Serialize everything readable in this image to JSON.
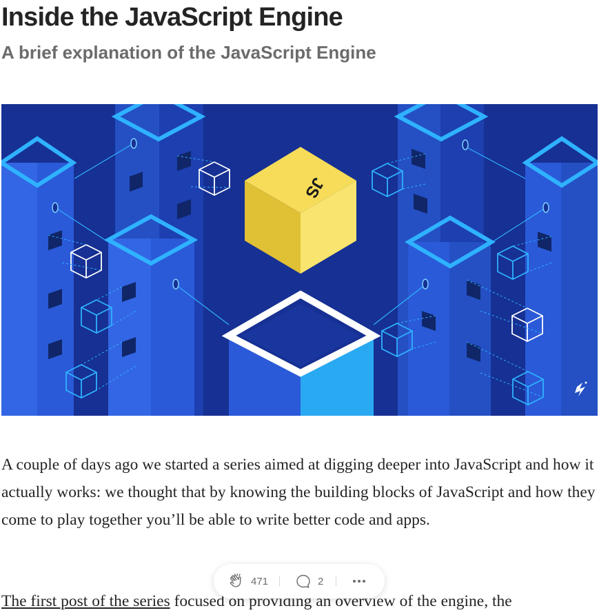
{
  "article": {
    "title": "Inside the JavaScript Engine",
    "subtitle": "A brief explanation of the JavaScript Engine",
    "hero_image": {
      "cube_label": "JS",
      "colors": {
        "background": "#163093",
        "pillar": "#2a5ad8",
        "pillar_light": "#3a72ee",
        "outline": "#2fb2ff",
        "cube_yellow": "#f6dc58",
        "cube_yellow_dark": "#e0c035",
        "base_blue": "#29a9f2"
      }
    },
    "paragraph1": "A couple of days ago we started a series aimed at digging deeper into JavaScript and how it actually works: we thought that by knowing the building blocks of JavaScript and how they come to play together you’ll be able to write better code and apps.",
    "paragraph2_link": "The first post of the series",
    "paragraph2_rest": " focused on providing an overview of the engine, the"
  },
  "actions": {
    "claps": "471",
    "responses": "2",
    "icons": [
      "clap-icon",
      "response-icon",
      "more-icon"
    ]
  }
}
